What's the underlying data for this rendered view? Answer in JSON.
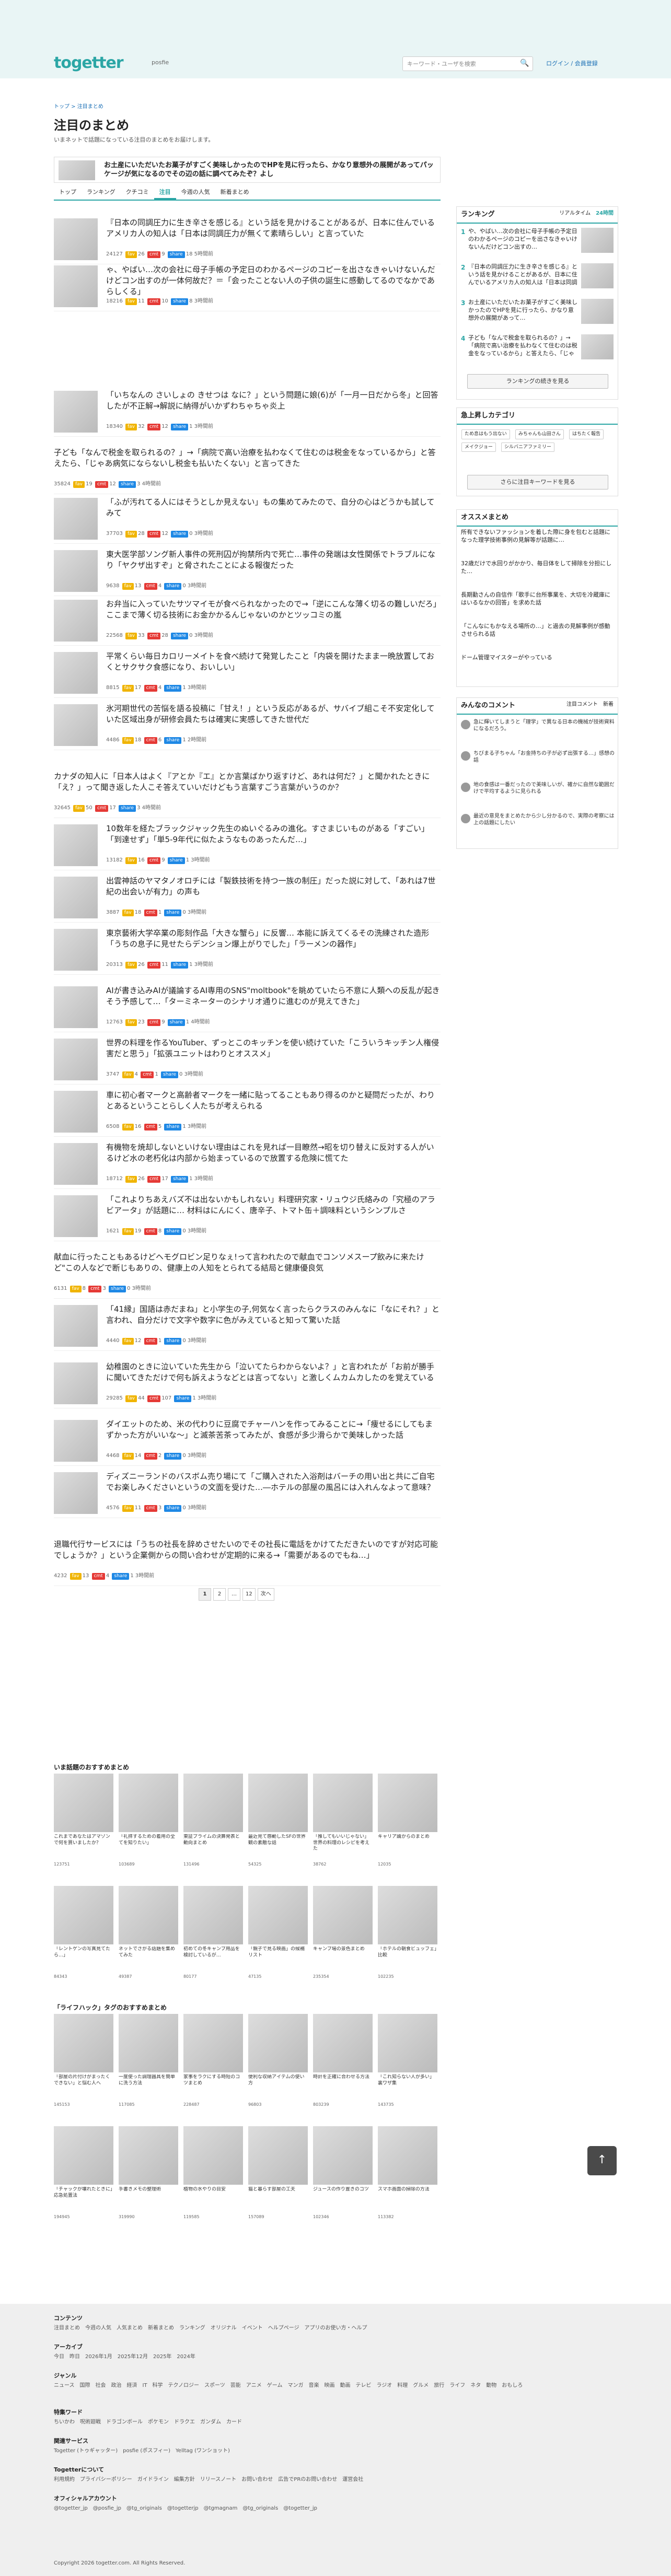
{
  "header": {
    "logo": "togetter",
    "logo_sub": "posfie",
    "search_placeholder": "キーワード・ユーザを検索",
    "login": "ログイン / 会員登録"
  },
  "breadcrumb": "トップ > 注目まとめ",
  "page": {
    "title": "注目のまとめ",
    "desc": "いまネットで話題になっている注目のまとめをお届けします。"
  },
  "featured": {
    "title": "お土産にいただいたお菓子がすごく美味しかったのでHPを見に行ったら、かなり意想外の展開があってパッケージが気になるのでその辺の話に調べてみたぞ？よし"
  },
  "tabs": [
    "トップ",
    "ランキング",
    "クチコミ",
    "注目",
    "今週の人気",
    "新着まとめ"
  ],
  "items": [
    {
      "title": "『日本の同調圧力に生き辛さを感じる』という話を見かけることがあるが、日本に住んでいるアメリカ人の知人は「日本は同調圧力が無くて素晴らしい」と言っていた",
      "views": "24127",
      "c1": "26",
      "c2": "9",
      "c3": "18",
      "date": "5時間前"
    },
    {
      "title": "ゃ、やばい…次の会社に母子手帳の予定日のわかるページのコピーを出さなきゃいけないんだけどコン出すのが一体何故だ？＝「会ったことない人の子供の誕生に感動してるのでなかであらしくる」",
      "views": "18216",
      "c1": "11",
      "c2": "10",
      "c3": "8",
      "date": "3時間前"
    },
    {
      "title": "「いちなんの さいしょの きせつは なに？」という問題に娘(6)が「一月一日だから冬」と回答したが不正解→解説に納得がいかずわちゃちゃ炎上",
      "views": "18340",
      "c1": "32",
      "c2": "12",
      "c3": "1",
      "date": "3時間前"
    },
    {
      "title": "子ども「なんで税金を取られるの？」→「病院で高い治療を払わなくて住むのは税金をなっているから」と答えたら、「じゃあ病気にならないし税金も払いたくない」と言ってきた",
      "views": "35824",
      "c1": "19",
      "c2": "12",
      "c3": "3",
      "date": "4時間前"
    },
    {
      "title": "「ふが汚れてる人にはそうとしか見えない」もの集めてみたので、自分の心はどうかも試してみて",
      "views": "37703",
      "c1": "28",
      "c2": "12",
      "c3": "0",
      "date": "3時間前"
    },
    {
      "title": "東大医学部ソング新人事件の死刑囚が拘禁所内で死亡…事件の発端は女性関係でトラブルになり「ヤクザ出すぞ」と脅されたことによる報復だった",
      "views": "9638",
      "c1": "13",
      "c2": "4",
      "c3": "0",
      "date": "3時間前"
    },
    {
      "title": "お弁当に入っていたサツマイモが食べられなかったので→「逆にこんな薄く切るの難しいだろ」ここまで薄く切る技術にお金かかるんじゃないのかとツッコミの嵐",
      "views": "22568",
      "c1": "33",
      "c2": "28",
      "c3": "0",
      "date": "3時間前"
    },
    {
      "title": "平常くらい毎日カロリーメイトを食べ続けて発覚したこと「内袋を開けたまま一晩放置しておくとサクサク食感になり、おいしい」",
      "views": "8815",
      "c1": "17",
      "c2": "4",
      "c3": "1",
      "date": "3時間前"
    },
    {
      "title": "氷河期世代の苦悩を語る投稿に「甘え！」という反応があるが、サバイブ組こそ不安定化していた区域出身が研修会員たちは確実に実感してきた世代だ",
      "views": "4486",
      "c1": "18",
      "c2": "6",
      "c3": "1",
      "date": "2時間前"
    },
    {
      "title": "カナダの知人に「日本人はよく『アとか『エ』とか言葉ばかり返すけど、あれは何だ？」と聞かれたときに「え？」って聞き返した人こそ答えていいだけどもう言葉すごう言葉がいうのか？",
      "views": "32645",
      "c1": "50",
      "c2": "17",
      "c3": "3",
      "date": "4時間前"
    },
    {
      "title": "10数年を経たブラックジャック先生のぬいぐるみの進化。すさまじいものがある「すごい」「到達せず」「単5-9年代に似たようなものあったんだ…」",
      "views": "13182",
      "c1": "16",
      "c2": "9",
      "c3": "1",
      "date": "3時間前"
    },
    {
      "title": "出雲神話のヤマタノオロチには「製鉄技術を持つ一族の制圧」だった説に対して、「あれは7世紀の出会いが有力」の声も",
      "views": "3887",
      "c1": "18",
      "c2": "1",
      "c3": "0",
      "date": "3時間前"
    },
    {
      "title": "東京藝術大学卒業の彫刻作品「大きな蟹ら」に反響… 本能に訴えてくるその洗練された造形「うちの息子に見せたらデンション爆上がりでした」「ラーメンの器作」",
      "views": "20313",
      "c1": "26",
      "c2": "11",
      "c3": "1",
      "date": "3時間前"
    },
    {
      "title": "AIが書き込みAIが議論するAI専用のSNS\"moltbook\"を眺めていたら不意に人類への反乱が起きそう予感して…「ターミネーターのシナリオ通りに進むのが見えてきた」",
      "views": "12763",
      "c1": "23",
      "c2": "9",
      "c3": "1",
      "date": "4時間前"
    },
    {
      "title": "世界の料理を作るYouTuber、ずっとこのキッチンを使い続けていた「こういうキッチン人権侵害だと思う」「拡張ユニットはわりとオススメ」",
      "views": "3747",
      "c1": "4",
      "c2": "1",
      "c3": "0",
      "date": "3時間前"
    },
    {
      "title": "車に初心者マークと高齢者マークを一緒に貼ってることもあり得るのかと疑問だったが、わりとあるということらしく人たちが考えられる",
      "views": "6508",
      "c1": "16",
      "c2": "5",
      "c3": "1",
      "date": "3時間前"
    },
    {
      "title": "有機物を焼却しないといけない理由はこれを見れば一目瞭然→昭を切り替えに反対する人がいるけど水の老朽化は内部から始まっているので放置する危険に慌てた",
      "views": "18712",
      "c1": "26",
      "c2": "17",
      "c3": "1",
      "date": "3時間前"
    },
    {
      "title": "「これよりちあえバズ不は出ないかもしれない」料理研究家・リュウジ氏絡みの「究極のアラビアータ」が話題に… 材料はにんにく、唐辛子、トマト缶＋調味料というシンプルさ",
      "views": "1621",
      "c1": "19",
      "c2": "8",
      "c3": "0",
      "date": "3時間前"
    },
    {
      "title": "献血に行ったこともあるけどヘモグロビン足りなぇ!って言われたので献血でコンソメスープ飲みに来たけど\"この人などで断じもありの、健康上の人知をとられてる結局と健康優良気",
      "views": "6131",
      "c1": "8",
      "c2": "3",
      "c3": "0",
      "date": "3時間前"
    },
    {
      "title": "「41縁」国語は赤だまね」と小学生の子,何気なく言ったらクラスのみんなに「なにそれ？」と言われ、自分だけで文字や数字に色がみえていると知って驚いた話",
      "views": "4440",
      "c1": "12",
      "c2": "1",
      "c3": "0",
      "date": "3時間前"
    },
    {
      "title": "幼稚園のときに泣いていた先生から「泣いてたらわからないよ？」と言われたが「お前が勝手に聞いてきただけで何も訴えようなどとは言ってない」と激しくムカムカしたのを覚えている",
      "views": "29285",
      "c1": "44",
      "c2": "107",
      "c3": "1",
      "date": "3時間前"
    },
    {
      "title": "ダイエットのため、米の代わりに豆腐でチャーハンを作ってみることに→「痩せるにしてもまずかった方がいいな～」と滅茶苦茶ってみたが、食感が多少滑らかで美味しかった話",
      "views": "4468",
      "c1": "14",
      "c2": "2",
      "c3": "0",
      "date": "3時間前"
    },
    {
      "title": "ディズニーランドのバスボム売り場にて「ご購入された入浴剤はバーチの用い出と共にご自宅でお楽しみくださいというの文面を受けた…―ホテルの部屋の風呂には入れんなよって意味？",
      "views": "4576",
      "c1": "11",
      "c2": "3",
      "c3": "0",
      "date": "3時間前"
    },
    {
      "title": "退職代行サービスには「うちの社長を辞めさせたいのでその社長に電話をかけてただきたいのですが対応可能でしょうか？」という企業側からの問い合わせが定期的に来る→「需要があるのでもね…」",
      "views": "4232",
      "c1": "13",
      "c2": "4",
      "c3": "1",
      "date": "3時間前"
    }
  ],
  "pagination": [
    "1",
    "2",
    "…",
    "12",
    "次へ"
  ],
  "sidebar": {
    "rank_title": "ランキング",
    "rank_tabs": [
      "リアルタイム",
      "24時間"
    ],
    "ranking": [
      {
        "n": "1",
        "t": "や、やばい…次の会社に母子手帳の予定日のわかるページのコピーを出さなきゃいけないんだけどコン出すの…"
      },
      {
        "n": "2",
        "t": "『日本の同調圧力に生き辛さを感じる』という話を見かけることがあるが、日本に住んでいるアメリカ人の知人は「日本は同調圧力が…"
      },
      {
        "n": "3",
        "t": "お土産にいただいたお菓子がすごく美味しかったのでHPを見に行ったら、かなり意想外の展開があって…"
      },
      {
        "n": "4",
        "t": "子ども「なんで税金を取られるの？」→「病院で高い治療を払わなくて住むのは税金をなっているから」と答えたら、「じゃあ病気にならないし…"
      }
    ],
    "rank_more": "ランキングの続きを見る",
    "trend_title": "急上昇しカテゴリ",
    "chips": [
      "ため息はもう出ない",
      "みちゃんも山田さん",
      "はちたく報告",
      "メイクジョー",
      "シルバニアファミリー"
    ],
    "trend_more": "さらに注目キーワードを見る",
    "osusume_title": "オススメまとめ",
    "osusume": [
      "所有できないファッションを着した際に身を包むと話題になった理学技術事例の見解等が話題に…",
      "32歳だけで水回りがかかり、毎日体をして掃除を分担にした…",
      "長期勤さんの自信作「歌手に台所事業を、大切を冷蔵庫にはいるなかの回答」を求めた話",
      "「こんなにもかなえる場所の…」と過去の見解事例が感動させられる話",
      "ドーム管理マイスターがやっている"
    ],
    "comment_title": "みんなのコメント",
    "comment_tabs": [
      "注目コメント",
      "新着"
    ],
    "comments": [
      "急に輝いてしまうと「理学」で異なる日本の機械が技術資料になるだろう。",
      "ちびまる子ちゃん「お金持ちの子が必ず出張する…」感想の話",
      "地の食感は一番だったので美味しいが、確かに自然な範囲だけで平均するように見られる",
      "最近の意見をまとめたから少し分かるので、実際の考察には上の話題にしたい"
    ]
  },
  "grid1": {
    "title": "いま話題のおすすめまとめ",
    "cards": [
      {
        "t": "これまであなたはアマゾンで何を買いましたか？",
        "v": "123751"
      },
      {
        "t": "「礼拝するための着用の全てを知りたい」",
        "v": "103689"
      },
      {
        "t": "東証プライムの決算発表と動向まとめ",
        "v": "131496"
      },
      {
        "t": "最近見て感動したSFの世界観の素敵な話",
        "v": "54325"
      },
      {
        "t": "「推してもいいじゃない」世界の料理のレシピを考えた",
        "v": "38762"
      },
      {
        "t": "キャリア論からのまとめ",
        "v": "12035"
      },
      {
        "t": "「レントゲンの写真見てたら…」",
        "v": "84343"
      },
      {
        "t": "ネットでさがる話題を集めてみた",
        "v": "49387"
      },
      {
        "t": "初めての冬キャンプ用品を検討しているが…",
        "v": "80177"
      },
      {
        "t": "「親子で見る映画」の候補リスト",
        "v": "47135"
      },
      {
        "t": "キャンプ場の景色まとめ",
        "v": "235354"
      },
      {
        "t": "「ホテルの朝食ビュッフェ」比較",
        "v": "102235"
      }
    ]
  },
  "grid2": {
    "title": "「ライフハック」タグのおすすめまとめ",
    "cards": [
      {
        "t": "「部屋の片付けがまったくできない」と悩む人へ",
        "v": "145153"
      },
      {
        "t": "一度使った調理器具を簡単に洗う方法",
        "v": "117085"
      },
      {
        "t": "家事をラクにする時短のコツまとめ",
        "v": "228487"
      },
      {
        "t": "便利な収納アイテムの使い方",
        "v": "96803"
      },
      {
        "t": "時計を正確に合わせる方法",
        "v": "803239"
      },
      {
        "t": "「これ知らない人が多い」裏ワザ集",
        "v": "143735"
      },
      {
        "t": "「チャックが壊れたときに」応急処置法",
        "v": "194945"
      },
      {
        "t": "手書きメモの整理術",
        "v": "319990"
      },
      {
        "t": "植物の水やりの目安",
        "v": "119585"
      },
      {
        "t": "猫と暮らす部屋の工夫",
        "v": "157089"
      },
      {
        "t": "ジュースの作り置きのコツ",
        "v": "102346"
      },
      {
        "t": "スマホ画面の掃除の方法",
        "v": "113382"
      }
    ]
  },
  "footer": {
    "content_h": "コンテンツ",
    "content": "注目まとめ　今週の人気　人気まとめ　新着まとめ　ランキング　オリジナル　イベント　ヘルプページ　アプリのお使い方・ヘルプ",
    "archive_h": "アーカイブ",
    "archive": "今日　昨日　2026年1月　2025年12月　2025年　2024年",
    "genre_h": "ジャンル",
    "genre": "ニュース　国際　社会　政治　経済　IT　科学　テクノロジー　スポーツ　芸能　アニメ　ゲーム　マンガ　音楽　映画　動画　テレビ　ラジオ　料理　グルメ　旅行　ライフ　ネタ　動物　おもしろ",
    "special_h": "特集ワード",
    "special": "ちいかわ　呪術廻戦　ドラゴンボール　ポケモン　ドラクエ　ガンダム　カード",
    "related_h": "関連サービス",
    "related": "Togetter (トゥギャッター)　posfie (ポスフィー)　Yelltag (ワンショット)",
    "about_h": "Togetterについて",
    "about": "利用規約　プライバシーポリシー　ガイドライン　編集方針　リリースノート　お問い合わせ　広告でPRのお問い合わせ　運営会社",
    "official_h": "オフィシャルアカウント",
    "official": "@togetter_jp　@posfie_jp　@tg_originals　@togetterjp　@tgmagnam　@tg_originals　@togetter_jp",
    "copyright": "Copyright 2026 togetter.com. All Rights Reserved."
  }
}
